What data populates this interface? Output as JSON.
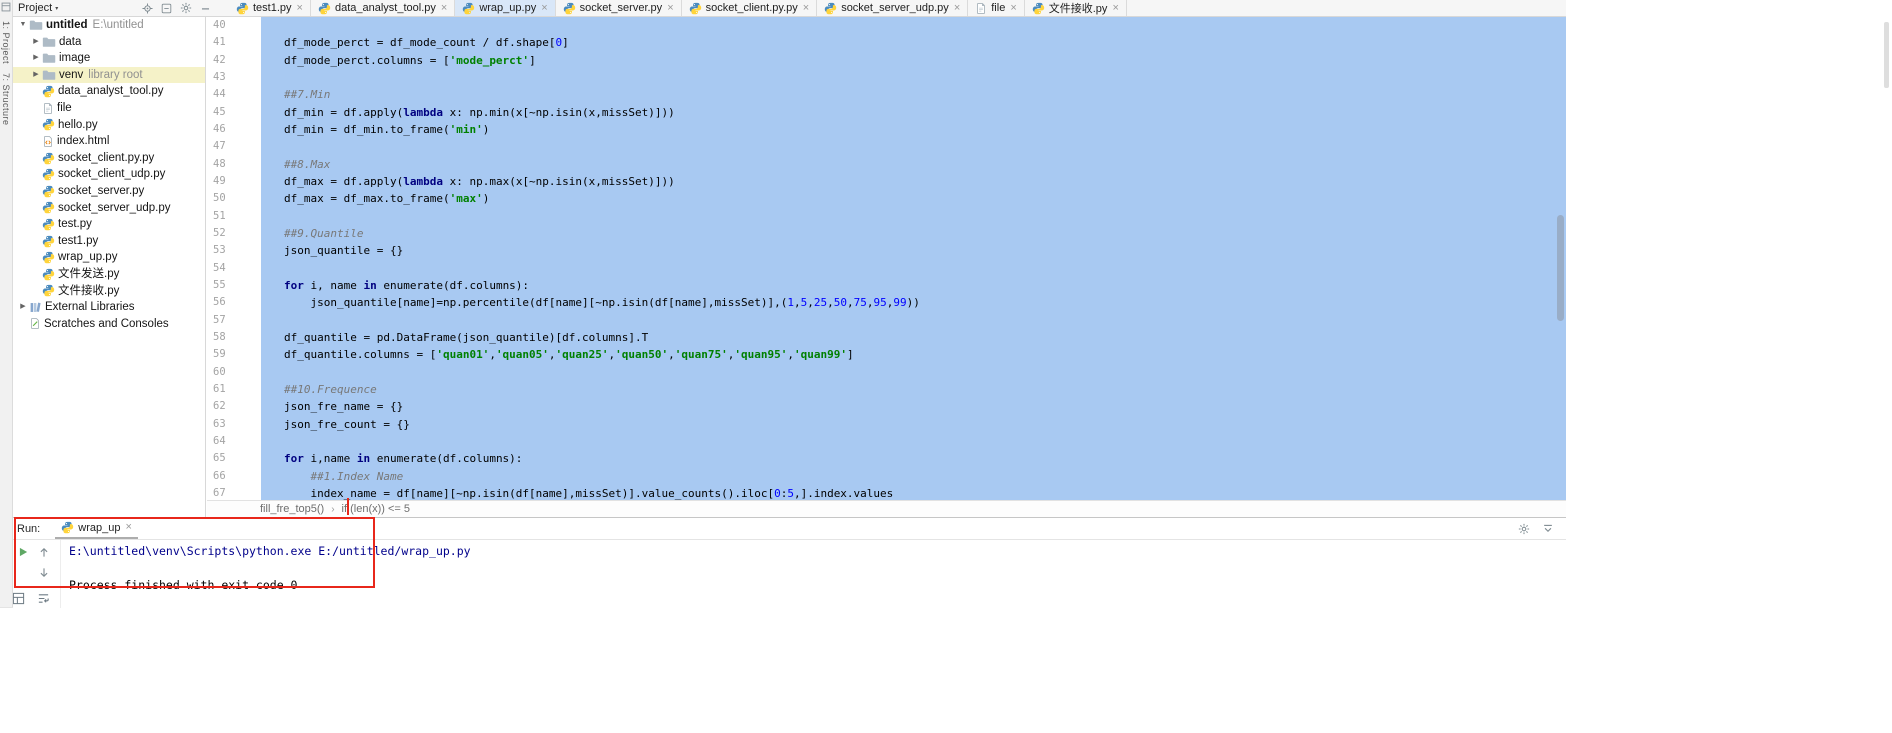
{
  "colors": {
    "selection": "#A8C9F2",
    "annotation": "#E8271B",
    "keyword": "#000080",
    "string": "#008000",
    "number": "#0000FF",
    "comment": "#787878",
    "command": "#00008B",
    "tree_selected": "#F5F2C8",
    "active_tab": "#D9E7F8"
  },
  "icon_glyphs": {
    "caret_down": "▾",
    "chevron_open": "▼",
    "chevron_closed": "▶",
    "close": "×",
    "breadcrumb_separator": "›"
  },
  "left_stripe": {
    "buttons": [
      {
        "label": "1: Project"
      },
      {
        "label": "7: Structure"
      }
    ]
  },
  "project_panel": {
    "header": {
      "title": "Project",
      "icons": [
        {
          "icon": "locate",
          "name": "locate-file-icon"
        },
        {
          "icon": "collapse",
          "name": "collapse-all-icon"
        },
        {
          "icon": "gear",
          "name": "settings-gear-icon"
        },
        {
          "icon": "hide",
          "name": "hide-panel-minus-icon"
        }
      ]
    },
    "tree": [
      {
        "label": "untitled",
        "annotation": "E:\\untitled",
        "icon": "folder",
        "chevron": "open",
        "bold": true,
        "indent": 0
      },
      {
        "label": "data",
        "icon": "folder",
        "chevron": "closed",
        "indent": 1
      },
      {
        "label": "image",
        "icon": "folder",
        "chevron": "closed",
        "indent": 1
      },
      {
        "label": "venv",
        "annotation": "library root",
        "icon": "folder",
        "chevron": "closed",
        "indent": 1,
        "selected": true
      },
      {
        "label": "data_analyst_tool.py",
        "icon": "python",
        "indent": 1
      },
      {
        "label": "file",
        "icon": "file",
        "indent": 1
      },
      {
        "label": "hello.py",
        "icon": "python",
        "indent": 1
      },
      {
        "label": "index.html",
        "icon": "html",
        "indent": 1
      },
      {
        "label": "socket_client.py.py",
        "icon": "python",
        "indent": 1
      },
      {
        "label": "socket_client_udp.py",
        "icon": "python",
        "indent": 1
      },
      {
        "label": "socket_server.py",
        "icon": "python",
        "indent": 1
      },
      {
        "label": "socket_server_udp.py",
        "icon": "python",
        "indent": 1
      },
      {
        "label": "test.py",
        "icon": "python",
        "indent": 1
      },
      {
        "label": "test1.py",
        "icon": "python",
        "indent": 1
      },
      {
        "label": "wrap_up.py",
        "icon": "python",
        "indent": 1
      },
      {
        "label": "文件发送.py",
        "icon": "python",
        "indent": 1
      },
      {
        "label": "文件接收.py",
        "icon": "python",
        "indent": 1
      },
      {
        "label": "External Libraries",
        "icon": "lib",
        "chevron": "closed",
        "indent": 0
      },
      {
        "label": "Scratches and Consoles",
        "icon": "scratch",
        "indent": 0
      }
    ]
  },
  "editor_tabs": [
    {
      "label": "test1.py",
      "icon": "python"
    },
    {
      "label": "data_analyst_tool.py",
      "icon": "python"
    },
    {
      "label": "wrap_up.py",
      "icon": "python",
      "active": true
    },
    {
      "label": "socket_server.py",
      "icon": "python"
    },
    {
      "label": "socket_client.py.py",
      "icon": "python"
    },
    {
      "label": "socket_server_udp.py",
      "icon": "python"
    },
    {
      "label": "file",
      "icon": "file"
    },
    {
      "label": "文件接收.py",
      "icon": "python"
    }
  ],
  "editor": {
    "lines": [
      {
        "n": 40,
        "parts": []
      },
      {
        "n": 41,
        "parts": [
          [
            "t",
            "df_mode_perct = df_mode_count / df.shape["
          ],
          [
            "num",
            "0"
          ],
          [
            "t",
            "]"
          ]
        ]
      },
      {
        "n": 42,
        "parts": [
          [
            "t",
            "df_mode_perct.columns = ["
          ],
          [
            "str",
            "'mode_perct'"
          ],
          [
            "t",
            "]"
          ]
        ]
      },
      {
        "n": 43,
        "parts": []
      },
      {
        "n": 44,
        "parts": [
          [
            "com",
            "##7.Min"
          ]
        ]
      },
      {
        "n": 45,
        "parts": [
          [
            "t",
            "df_min = df.apply("
          ],
          [
            "kw",
            "lambda"
          ],
          [
            "t",
            " x: np.min(x[~np.isin(x,missSet)]))"
          ]
        ]
      },
      {
        "n": 46,
        "parts": [
          [
            "t",
            "df_min = df_min.to_frame("
          ],
          [
            "str",
            "'min'"
          ],
          [
            "t",
            ")"
          ]
        ]
      },
      {
        "n": 47,
        "parts": []
      },
      {
        "n": 48,
        "parts": [
          [
            "com",
            "##8.Max"
          ]
        ]
      },
      {
        "n": 49,
        "parts": [
          [
            "t",
            "df_max = df.apply("
          ],
          [
            "kw",
            "lambda"
          ],
          [
            "t",
            " x: np.max(x[~np.isin(x,missSet)]))"
          ]
        ]
      },
      {
        "n": 50,
        "parts": [
          [
            "t",
            "df_max = df_max.to_frame("
          ],
          [
            "str",
            "'max'"
          ],
          [
            "t",
            ")"
          ]
        ]
      },
      {
        "n": 51,
        "parts": []
      },
      {
        "n": 52,
        "parts": [
          [
            "com",
            "##9.Quantile"
          ]
        ]
      },
      {
        "n": 53,
        "parts": [
          [
            "t",
            "json_quantile = {}"
          ]
        ]
      },
      {
        "n": 54,
        "parts": []
      },
      {
        "n": 55,
        "parts": [
          [
            "kw",
            "for"
          ],
          [
            "t",
            " i, name "
          ],
          [
            "kw",
            "in"
          ],
          [
            "t",
            " enumerate(df.columns):"
          ]
        ]
      },
      {
        "n": 56,
        "parts": [
          [
            "t",
            "    json_quantile[name]=np.percentile(df[name][~np.isin(df[name],missSet)],("
          ],
          [
            "num",
            "1"
          ],
          [
            "t",
            ","
          ],
          [
            "num",
            "5"
          ],
          [
            "t",
            ","
          ],
          [
            "num",
            "25"
          ],
          [
            "t",
            ","
          ],
          [
            "num",
            "50"
          ],
          [
            "t",
            ","
          ],
          [
            "num",
            "75"
          ],
          [
            "t",
            ","
          ],
          [
            "num",
            "95"
          ],
          [
            "t",
            ","
          ],
          [
            "num",
            "99"
          ],
          [
            "t",
            "))"
          ]
        ]
      },
      {
        "n": 57,
        "parts": []
      },
      {
        "n": 58,
        "parts": [
          [
            "t",
            "df_quantile = pd.DataFrame(json_quantile)[df.columns].T"
          ]
        ]
      },
      {
        "n": 59,
        "parts": [
          [
            "t",
            "df_quantile.columns = ["
          ],
          [
            "str",
            "'quan01'"
          ],
          [
            "t",
            ","
          ],
          [
            "str",
            "'quan05'"
          ],
          [
            "t",
            ","
          ],
          [
            "str",
            "'quan25'"
          ],
          [
            "t",
            ","
          ],
          [
            "str",
            "'quan50'"
          ],
          [
            "t",
            ","
          ],
          [
            "str",
            "'quan75'"
          ],
          [
            "t",
            ","
          ],
          [
            "str",
            "'quan95'"
          ],
          [
            "t",
            ","
          ],
          [
            "str",
            "'quan99'"
          ],
          [
            "t",
            "]"
          ]
        ]
      },
      {
        "n": 60,
        "parts": []
      },
      {
        "n": 61,
        "parts": [
          [
            "com",
            "##10.Frequence"
          ]
        ]
      },
      {
        "n": 62,
        "parts": [
          [
            "t",
            "json_fre_name = {}"
          ]
        ]
      },
      {
        "n": 63,
        "parts": [
          [
            "t",
            "json_fre_count = {}"
          ]
        ]
      },
      {
        "n": 64,
        "parts": []
      },
      {
        "n": 65,
        "parts": [
          [
            "kw",
            "for"
          ],
          [
            "t",
            " i,name "
          ],
          [
            "kw",
            "in"
          ],
          [
            "t",
            " enumerate(df.columns):"
          ]
        ]
      },
      {
        "n": 66,
        "parts": [
          [
            "t",
            "    "
          ],
          [
            "com",
            "##1.Index Name"
          ]
        ]
      },
      {
        "n": 67,
        "parts": [
          [
            "t",
            "    index_name = df[name][~np.isin(df[name],missSet)].value_counts().iloc["
          ],
          [
            "num",
            "0"
          ],
          [
            "t",
            ":"
          ],
          [
            "num",
            "5"
          ],
          [
            "t",
            ",].index.values"
          ]
        ]
      }
    ]
  },
  "breadcrumbs": {
    "items": [
      "fill_fre_top5()",
      "if (len(x)) <= 5"
    ]
  },
  "run_panel": {
    "label": "Run:",
    "tab": {
      "label": "wrap_up",
      "icon": "python"
    },
    "header_icons": [
      {
        "icon": "gear",
        "name": "settings-gear-icon"
      },
      {
        "icon": "hidepanel",
        "name": "hide-panel-icon"
      }
    ],
    "toolbar_columns": [
      [
        {
          "icon": "rerun",
          "name": "rerun-icon"
        }
      ],
      [
        {
          "icon": "up",
          "name": "up-arrow-icon"
        },
        {
          "icon": "down",
          "name": "down-arrow-icon"
        }
      ]
    ],
    "bottom_buttons": [
      {
        "icon": "layout",
        "name": "restore-layout-icon"
      },
      {
        "icon": "wrap",
        "name": "soft-wrap-icon"
      }
    ],
    "console": [
      {
        "text": "E:\\untitled\\venv\\Scripts\\python.exe E:/untitled/wrap_up.py",
        "type": "command"
      },
      {
        "text": ""
      },
      {
        "text": "Process finished with exit code 0",
        "type": "normal"
      }
    ]
  }
}
